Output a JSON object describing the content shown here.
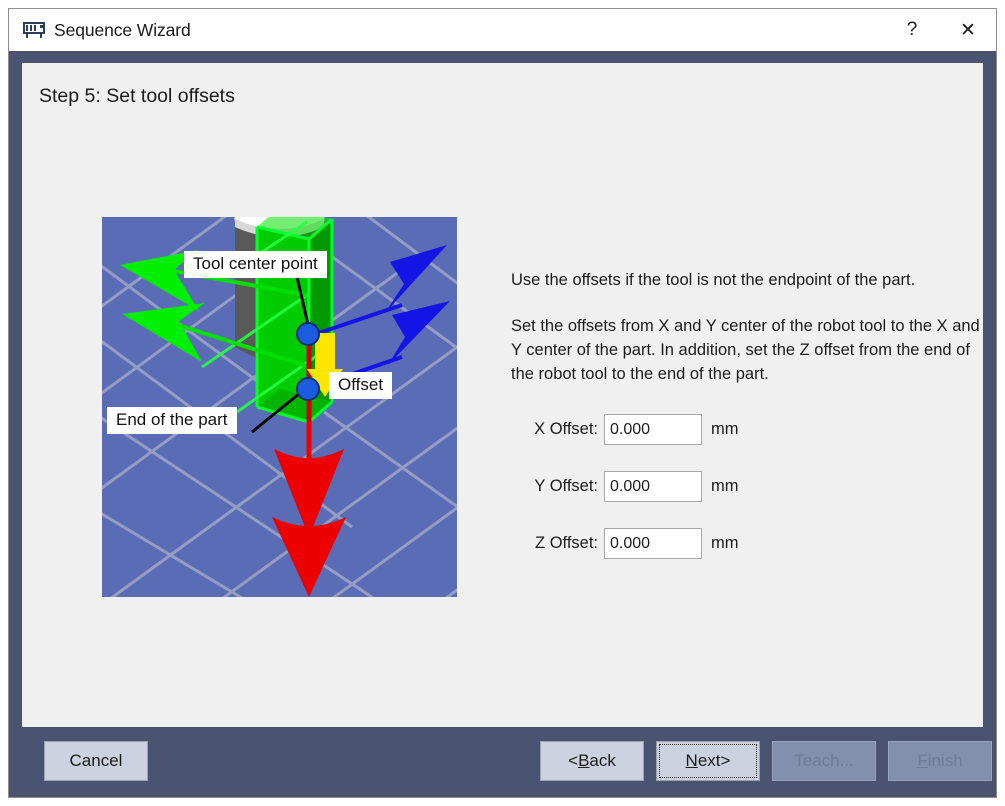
{
  "window": {
    "title": "Sequence Wizard",
    "icon": "controller-icon",
    "help_button": "?",
    "close_button": "✕"
  },
  "step": {
    "title": "Step 5: Set tool offsets"
  },
  "illustration": {
    "name": "robot-tool-offset-3d-view",
    "background_color": "#5a6cb5",
    "labels": {
      "tool_center_point": "Tool center point",
      "offset": "Offset",
      "end_of_part": "End of the part"
    },
    "colors": {
      "x_axis_arrow": "#00e000",
      "y_axis_arrow": "#1414e6",
      "z_axis_arrow": "#ee0000",
      "offset_arrow": "#ffe600",
      "part": "#00c400",
      "tool_body": "#4a4a4a",
      "marker_point": "#1a5ce0",
      "grid_line": "#9aa3c8"
    }
  },
  "instructions": {
    "paragraph1": "Use the offsets if the tool is not the endpoint of the part.",
    "paragraph2": "Set the offsets from X and Y center of the robot tool to the X and Y center of the part.  In addition, set the Z offset from the end of the robot tool to the end of the part."
  },
  "offsets": {
    "unit": "mm",
    "fields": [
      {
        "label": "X Offset:",
        "value": "0.000",
        "placeholder": "0.000",
        "name": "x-offset"
      },
      {
        "label": "Y Offset:",
        "value": "0.000",
        "placeholder": "0.000",
        "name": "y-offset"
      },
      {
        "label": "Z Offset:",
        "value": "0.000",
        "placeholder": "0.000",
        "name": "z-offset"
      }
    ]
  },
  "footer": {
    "cancel": "Cancel",
    "back_prefix": "< ",
    "back_accel": "B",
    "back_rest": "ack",
    "next_accel": "N",
    "next_rest": "ext",
    "next_suffix": " >",
    "teach": "Teach...",
    "finish_accel": "F",
    "finish_rest": "inish",
    "focused_button": "Next >",
    "disabled_buttons": [
      "Teach...",
      "Finish"
    ]
  }
}
